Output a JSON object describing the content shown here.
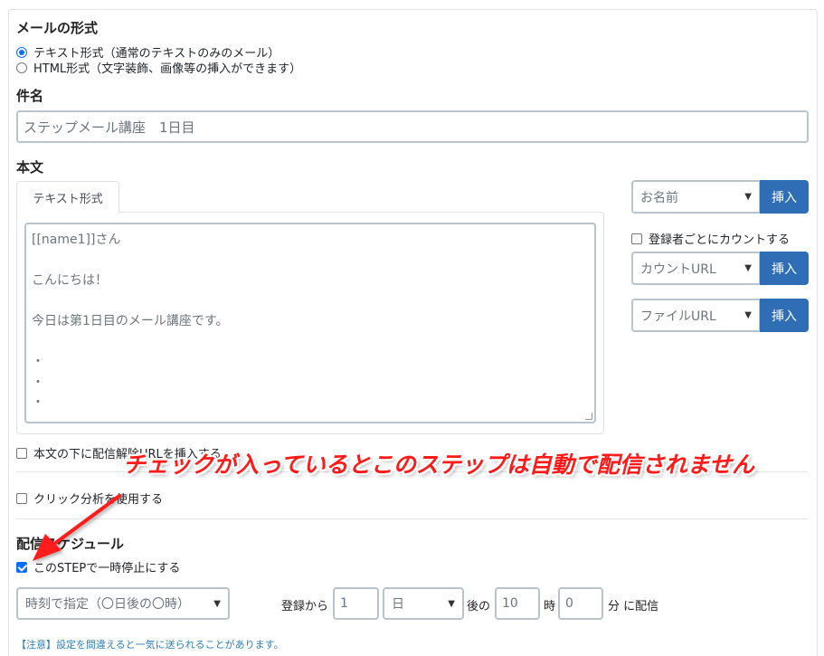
{
  "mail_format": {
    "title": "メールの形式",
    "options": [
      {
        "label": "テキスト形式（通常のテキストのみのメール）",
        "checked": true
      },
      {
        "label": "HTML形式（文字装飾、画像等の挿入ができます）",
        "checked": false
      }
    ]
  },
  "subject": {
    "title": "件名",
    "value": "ステップメール講座　1日目"
  },
  "body": {
    "title": "本文",
    "tab_label": "テキスト形式",
    "lines": [
      "[[name1]]さん",
      "",
      "こんにちは！",
      "",
      "今日は第1日目のメール講座です。",
      "",
      "・",
      "・",
      "・"
    ]
  },
  "insert_panel": {
    "name_select": "お名前",
    "insert_label": "挿入",
    "count_checkbox_label": "登録者ごとにカウントする",
    "count_url_select": "カウントURL",
    "file_url_select": "ファイルURL"
  },
  "options": {
    "unsubscribe_label": "本文の下に配信解除URLを挿入する",
    "click_analysis_label": "クリック分析を使用する"
  },
  "schedule": {
    "title": "配信スケジュール",
    "pause_label": "このSTEPで一時停止にする",
    "pause_checked": true,
    "timing_select": "時刻で指定（〇日後の〇時）",
    "from_label": "登録から",
    "days_value": "1",
    "unit_select": "日",
    "after_label": "後の",
    "hour_value": "10",
    "hour_label": "時",
    "minute_value": "0",
    "minute_label": "分 に配信",
    "note": "【注意】設定を間違えると一気に送られることがあります。"
  },
  "annotation": {
    "text": "チェックが入っているとこのステップは自動で配信されません",
    "color": "#ff1a1a"
  },
  "colors": {
    "accent": "#0d6efd",
    "button": "#2f6db4",
    "note": "#2f7fb3"
  }
}
